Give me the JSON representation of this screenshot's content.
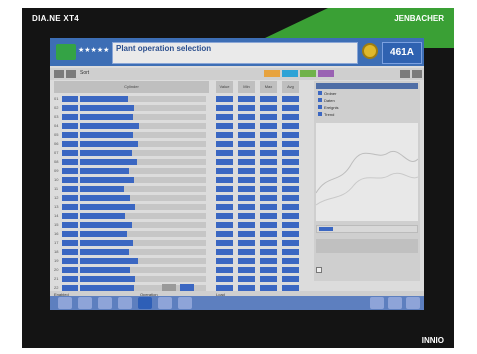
{
  "device": {
    "left_brand": "DIA.NE XT4",
    "right_brand": "JENBACHER",
    "corner_brand": "INNIO"
  },
  "header": {
    "power_value": "461A",
    "message_title": "Plant operation selection",
    "message_subtitle": "",
    "stars": "★★★★★"
  },
  "toolbar": {
    "label": "Sort",
    "tags": [
      {
        "text": "",
        "color": "#e7a33f"
      },
      {
        "text": "",
        "color": "#2fa3d6"
      },
      {
        "text": "",
        "color": "#70b24a"
      },
      {
        "text": "",
        "color": "#9a62b3"
      }
    ]
  },
  "columns_header": [
    "Cylinder",
    "Value",
    "Min",
    "Max",
    "Avg"
  ],
  "table": {
    "rows": [
      {
        "n": "01",
        "fill": 0.38
      },
      {
        "n": "02",
        "fill": 0.43
      },
      {
        "n": "03",
        "fill": 0.42
      },
      {
        "n": "04",
        "fill": 0.47
      },
      {
        "n": "05",
        "fill": 0.42
      },
      {
        "n": "06",
        "fill": 0.46
      },
      {
        "n": "07",
        "fill": 0.41
      },
      {
        "n": "08",
        "fill": 0.45
      },
      {
        "n": "09",
        "fill": 0.39
      },
      {
        "n": "10",
        "fill": 0.43
      },
      {
        "n": "11",
        "fill": 0.35
      },
      {
        "n": "12",
        "fill": 0.4
      },
      {
        "n": "13",
        "fill": 0.44
      },
      {
        "n": "14",
        "fill": 0.36
      },
      {
        "n": "15",
        "fill": 0.41
      },
      {
        "n": "16",
        "fill": 0.37
      },
      {
        "n": "17",
        "fill": 0.42
      },
      {
        "n": "18",
        "fill": 0.39
      },
      {
        "n": "19",
        "fill": 0.46
      },
      {
        "n": "20",
        "fill": 0.4
      },
      {
        "n": "21",
        "fill": 0.44
      },
      {
        "n": "22",
        "fill": 0.43
      }
    ]
  },
  "right_panel": {
    "list_items": [
      "Ordner",
      "Daten",
      "Ereignis",
      "Trend"
    ],
    "scale_labels": [
      "1h",
      "2h",
      "4h",
      "8h",
      "24h"
    ],
    "checkbox_label": ""
  },
  "statusbar": {
    "left": "Enabled",
    "mid": "Operation",
    "mid2": "Load",
    "right": ""
  },
  "colors": {
    "accent": "#3b67c2",
    "brand_green": "#3aa035",
    "header_blue": "#3d6eb5"
  },
  "navbar_icons": [
    "home-icon",
    "user-icon",
    "list-icon",
    "chart-icon",
    "gear-icon",
    "alarm-icon",
    "tools-icon",
    "back-icon",
    "help-icon",
    "exit-icon"
  ]
}
